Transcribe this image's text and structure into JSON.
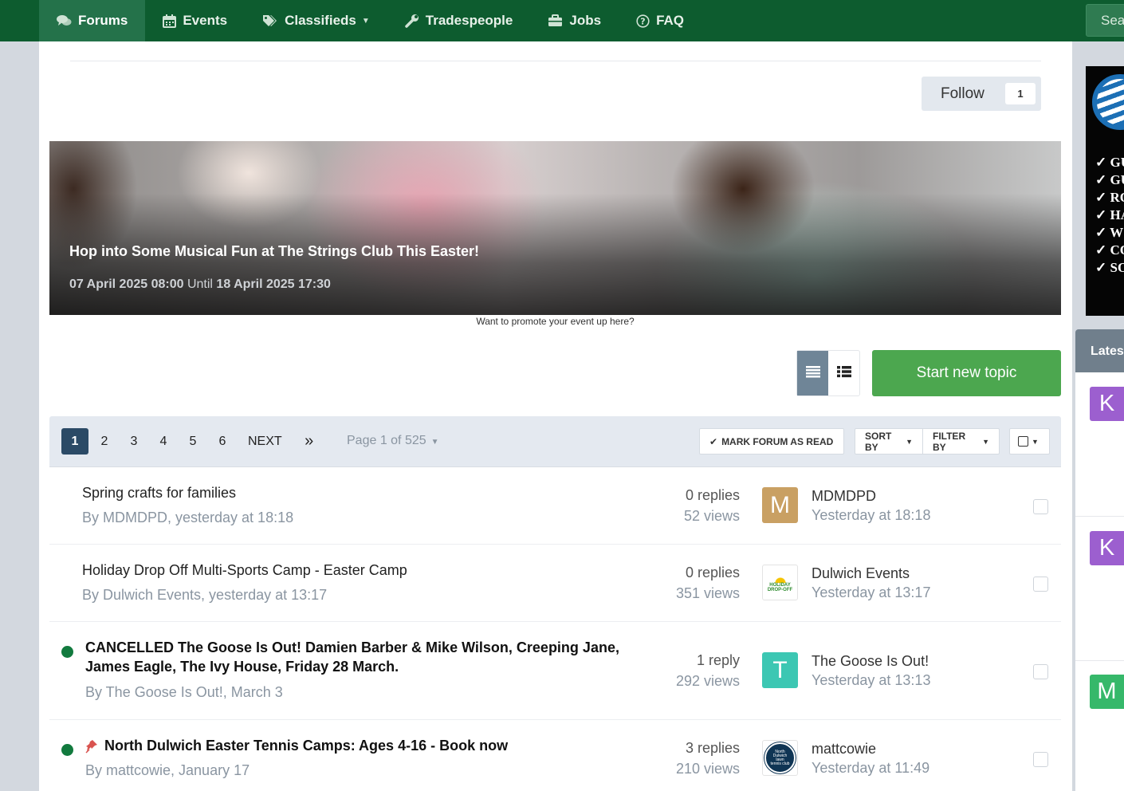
{
  "nav": {
    "items": [
      {
        "label": "Forums",
        "icon": "comments-icon",
        "active": true
      },
      {
        "label": "Events",
        "icon": "calendar-icon",
        "active": false
      },
      {
        "label": "Classifieds",
        "icon": "tags-icon",
        "active": false,
        "dropdown": true
      },
      {
        "label": "Tradespeople",
        "icon": "wrench-icon",
        "active": false
      },
      {
        "label": "Jobs",
        "icon": "briefcase-icon",
        "active": false
      },
      {
        "label": "FAQ",
        "icon": "question-circle-icon",
        "active": false
      }
    ],
    "search_placeholder": "Sea"
  },
  "follow": {
    "label": "Follow",
    "count": "1"
  },
  "event_banner": {
    "title": "Hop into Some Musical Fun at The Strings Club This Easter!",
    "start": "07 April 2025 08:00",
    "until": "Until",
    "end": "18 April 2025 17:30"
  },
  "promote_text": "Want to promote your event up here?",
  "start_topic_label": "Start new topic",
  "view_toggle": {
    "selected": "table-view"
  },
  "pagination": {
    "pages": [
      "1",
      "2",
      "3",
      "4",
      "5",
      "6"
    ],
    "current": "1",
    "next_label": "NEXT",
    "last_label": "»",
    "page_of": "Page 1 of 525"
  },
  "actions": {
    "mark_read": "MARK FORUM AS READ",
    "sort_by": "SORT BY",
    "filter_by": "FILTER BY"
  },
  "topics": [
    {
      "title": "Spring crafts for families",
      "byline": "By MDMDPD, yesterday at 18:18",
      "unread": false,
      "replies": "0 replies",
      "views": "52 views",
      "last_poster": "MDMDPD",
      "last_time": "Yesterday at 18:18",
      "avatar_letter": "M",
      "avatar_color": "#c9a063"
    },
    {
      "title": "Holiday Drop Off Multi-Sports Camp - Easter Camp",
      "byline": "By Dulwich Events, yesterday at 13:17",
      "unread": false,
      "replies": "0 replies",
      "views": "351 views",
      "last_poster": "Dulwich Events",
      "last_time": "Yesterday at 13:17",
      "avatar_logo_text": "HOLIDAY DROP-OFF"
    },
    {
      "title_line1": "CANCELLED The Goose Is Out! Damien Barber & Mike Wilson, Creeping Jane,",
      "title_line2": "James Eagle, The Ivy House, Friday 28 March.",
      "byline": "By The Goose Is Out!, March 3",
      "unread": true,
      "replies": "1 reply",
      "views": "292 views",
      "last_poster": "The Goose Is Out!",
      "last_time": "Yesterday at 13:13",
      "avatar_letter": "T",
      "avatar_color": "#3cc7b3"
    },
    {
      "title": "North Dulwich Easter Tennis Camps: Ages 4-16 - Book now",
      "byline": "By mattcowie, January 17",
      "unread": true,
      "pinned": true,
      "replies": "3 replies",
      "views": "210 views",
      "last_poster": "mattcowie",
      "last_time": "Yesterday at 11:49",
      "avatar_logo_text": "North Dulwich lawn tennis club"
    }
  ],
  "sidebar": {
    "ad_lines": [
      "✓ GU",
      "✓ GU",
      "✓ RO",
      "✓ HA",
      "✓ W",
      "✓ CO",
      "✓ SO"
    ],
    "latest_label": "Lates",
    "avatars": [
      {
        "letter": "K",
        "color": "#9c5fcf"
      },
      {
        "letter": "K",
        "color": "#9c5fcf"
      },
      {
        "letter": "M",
        "color": "#36b86a"
      }
    ]
  },
  "colors": {
    "nav_bg": "#0d5c2f",
    "start_button": "#4ca74f",
    "current_page": "#2b4a66",
    "unread_dot": "#127a3e"
  }
}
